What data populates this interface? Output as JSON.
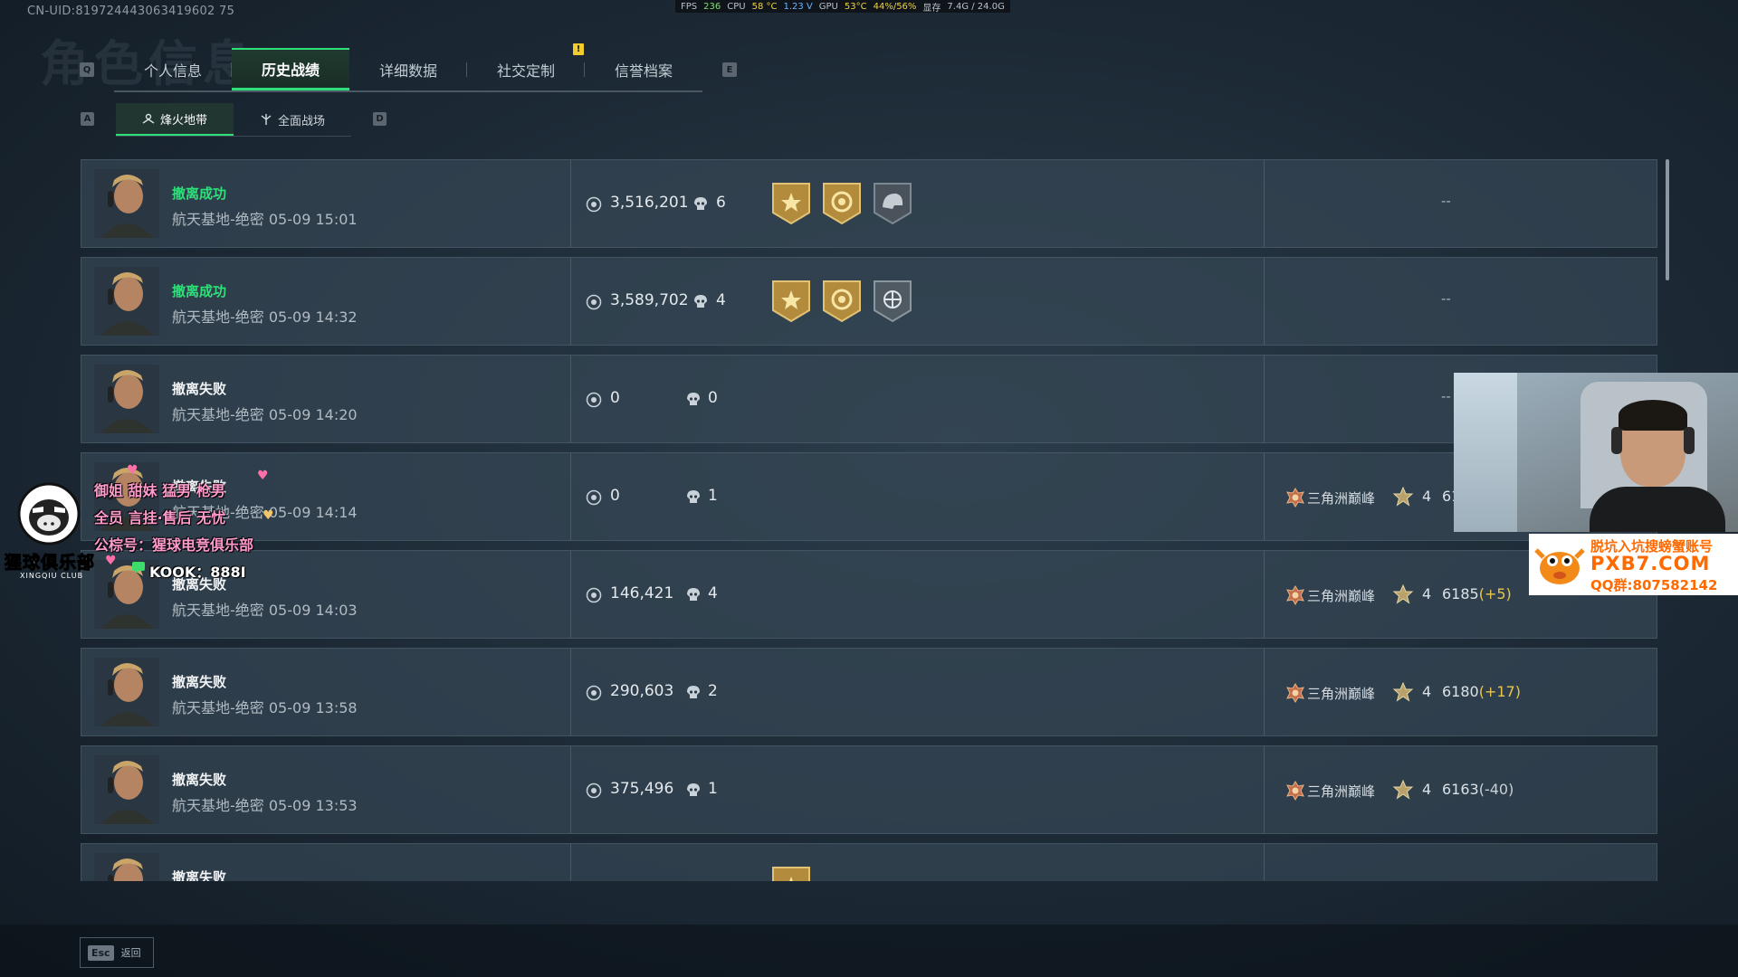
{
  "perf": {
    "fps_label": "FPS",
    "fps": "236",
    "cpu_label": "CPU",
    "cpu_temp": "58 °C",
    "cpu_volt": "1.23 V",
    "gpu_label": "GPU",
    "gpu_temp": "53°C",
    "gpu_load": "44%/56%",
    "mem_label": "显存",
    "mem": "7.4G / 24.0G"
  },
  "uid": "CN-UID:819724443063419602 75",
  "ghost_title": "角色信息",
  "tabs": {
    "left_key": "Q",
    "right_key": "E",
    "items": [
      {
        "label": "个人信息",
        "active": false
      },
      {
        "label": "历史战绩",
        "active": true
      },
      {
        "label": "详细数据",
        "active": false
      },
      {
        "label": "社交定制",
        "active": false
      },
      {
        "label": "信誉档案",
        "active": false
      }
    ],
    "notification": "!"
  },
  "subtabs": {
    "left_key": "A",
    "right_key": "D",
    "items": [
      {
        "label": "烽火地带",
        "active": true
      },
      {
        "label": "全面战场",
        "active": false
      }
    ]
  },
  "matches": [
    {
      "status": "撤离成功",
      "success": true,
      "map": "航天基地-绝密",
      "time": "05-09 15:01",
      "value": "3,516,201",
      "kills": "6",
      "badges": [
        "gold-star",
        "gold-coin",
        "gray-helmet"
      ],
      "rank": "--"
    },
    {
      "status": "撤离成功",
      "success": true,
      "map": "航天基地-绝密",
      "time": "05-09 14:32",
      "value": "3,589,702",
      "kills": "4",
      "badges": [
        "gold-star",
        "gold-coin",
        "gray-target"
      ],
      "rank": "--"
    },
    {
      "status": "撤离失败",
      "success": false,
      "map": "航天基地-绝密",
      "time": "05-09 14:20",
      "value": "0",
      "kills": "0",
      "badges": [],
      "rank": "--"
    },
    {
      "status": "撤离失败",
      "success": false,
      "map": "航天基地-绝密",
      "time": "05-09 14:14",
      "value": "0",
      "kills": "1",
      "badges": [],
      "rank": {
        "name": "三角洲巅峰",
        "level": "4",
        "score": "61",
        "delta": "",
        "delta_type": "pos"
      }
    },
    {
      "status": "撤离失败",
      "success": false,
      "map": "航天基地-绝密",
      "time": "05-09 14:03",
      "value": "146,421",
      "kills": "4",
      "badges": [],
      "rank": {
        "name": "三角洲巅峰",
        "level": "4",
        "score": "6185",
        "delta": "(+5)",
        "delta_type": "pos"
      }
    },
    {
      "status": "撤离失败",
      "success": false,
      "map": "航天基地-绝密",
      "time": "05-09 13:58",
      "value": "290,603",
      "kills": "2",
      "badges": [],
      "rank": {
        "name": "三角洲巅峰",
        "level": "4",
        "score": "6180",
        "delta": "(+17)",
        "delta_type": "pos"
      }
    },
    {
      "status": "撤离失败",
      "success": false,
      "map": "航天基地-绝密",
      "time": "05-09 13:53",
      "value": "375,496",
      "kills": "1",
      "badges": [],
      "rank": {
        "name": "三角洲巅峰",
        "level": "4",
        "score": "6163",
        "delta": "(-40)",
        "delta_type": "neg"
      }
    },
    {
      "status": "撤离失败",
      "success": false,
      "map": "",
      "time": "",
      "value": "",
      "kills": "",
      "badges": [
        "gold-star"
      ],
      "rank": ""
    }
  ],
  "footer": {
    "key": "Esc",
    "label": "返回"
  },
  "overlay": {
    "lines": [
      "御姐  甜妹  猛男  枪男",
      "全员  言挂·售后  无忧",
      "公棕号：猩球电竞俱乐部",
      "KOOK：888I"
    ],
    "logo_text": "猩球俱乐部",
    "logo_sub": "XINGQIU CLUB"
  },
  "ad": {
    "line1": "脱坑入坑搜螃蟹账号",
    "line2": "PXB7.COM",
    "line3": "QQ群:807582142"
  },
  "colors": {
    "success": "#2ee07a",
    "accent": "#2ee07a",
    "gold": "#e8c64a",
    "notif": "#f1cc2d"
  }
}
